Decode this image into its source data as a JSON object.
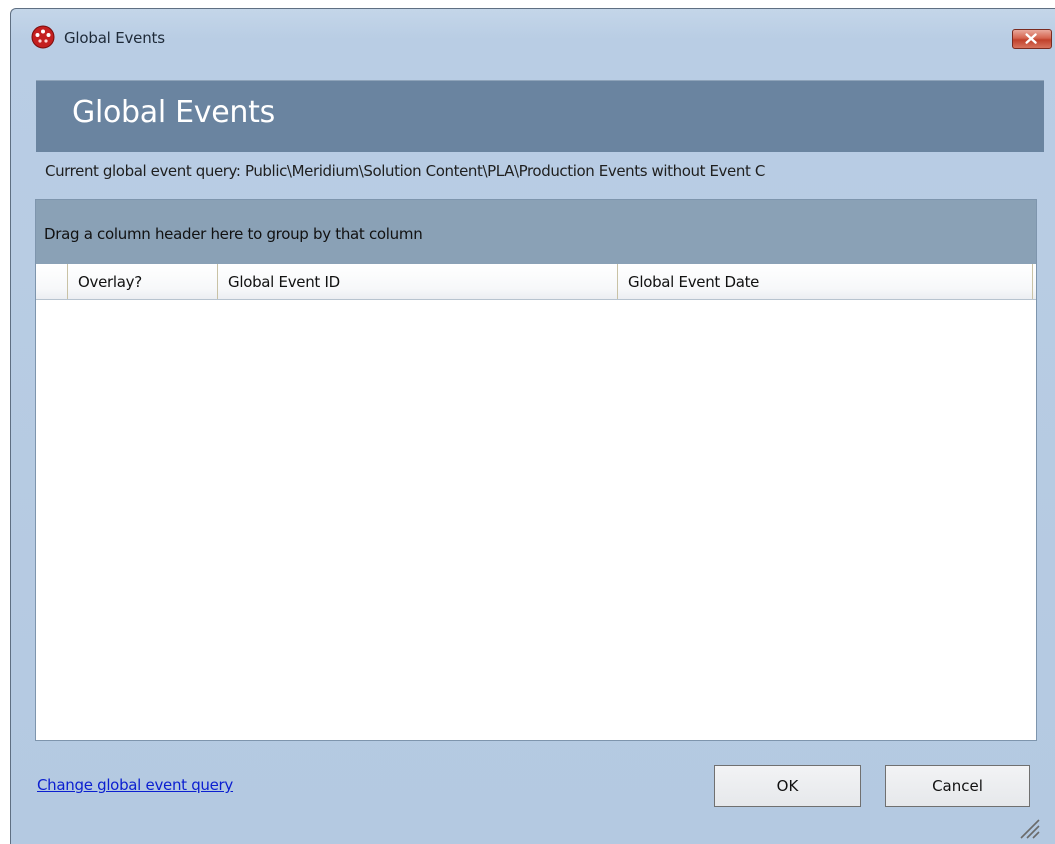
{
  "window": {
    "title": "Global Events"
  },
  "header": {
    "title": "Global Events"
  },
  "query": {
    "text": "Current global event query: Public\\Meridium\\Solution Content\\PLA\\Production Events without Event C"
  },
  "grid": {
    "group_hint": "Drag a column header here to group by that column",
    "columns": [
      {
        "label": "Overlay?"
      },
      {
        "label": "Global Event ID"
      },
      {
        "label": "Global Event Date"
      }
    ],
    "rows": []
  },
  "footer": {
    "change_query_link": "Change global event query",
    "ok_label": "OK",
    "cancel_label": "Cancel"
  },
  "icons": {
    "app": "meridium-app-icon",
    "close": "close-icon",
    "resize": "resize-grip-icon"
  },
  "colors": {
    "banner": "#6a84a0",
    "group_panel": "#8aa1b6",
    "link": "#0b1fd0",
    "close_button": "#c0412b"
  }
}
